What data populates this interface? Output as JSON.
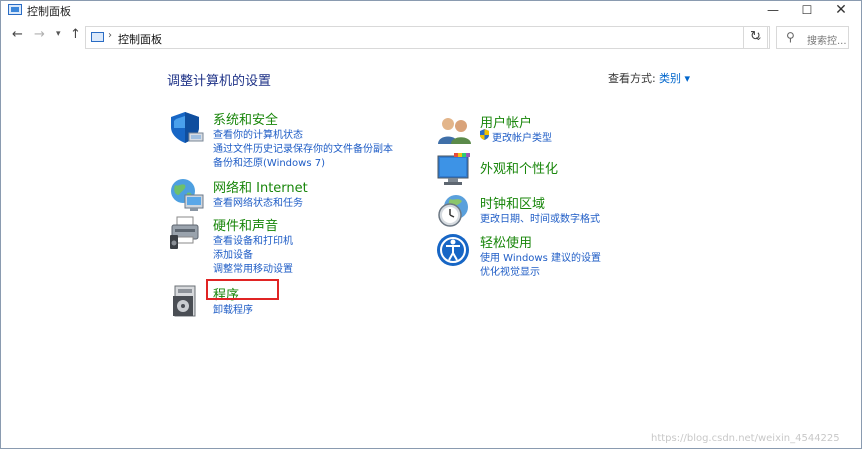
{
  "window": {
    "title": "控制面板",
    "controls": {
      "minimize": "—",
      "maximize": "☐",
      "close": "✕"
    }
  },
  "navigation": {
    "back": "←",
    "forward": "→",
    "recent": "▾",
    "up": "↑",
    "address_separator": "›",
    "address_path": "控制面板",
    "address_dropdown": "⌄",
    "refresh": "↻",
    "search_placeholder": "搜索控..."
  },
  "main": {
    "heading": "调整计算机的设置",
    "view_by_label": "查看方式:",
    "view_by_value": "类别 ▾",
    "categories_left": [
      {
        "title": "系统和安全",
        "links": [
          "查看你的计算机状态",
          "通过文件历史记录保存你的文件备份副本",
          "备份和还原(Windows 7)"
        ]
      },
      {
        "title": "网络和 Internet",
        "links": [
          "查看网络状态和任务"
        ]
      },
      {
        "title": "硬件和声音",
        "links": [
          "查看设备和打印机",
          "添加设备",
          "调整常用移动设置"
        ]
      },
      {
        "title": "程序",
        "links": [
          "卸载程序"
        ]
      }
    ],
    "categories_right": [
      {
        "title": "用户帐户",
        "links": [
          "更改帐户类型"
        ]
      },
      {
        "title": "外观和个性化",
        "links": []
      },
      {
        "title": "时钟和区域",
        "links": [
          "更改日期、时间或数字格式"
        ]
      },
      {
        "title": "轻松使用",
        "links": [
          "使用 Windows 建议的设置",
          "优化视觉显示"
        ]
      }
    ]
  },
  "watermark": "https://blog.csdn.net/weixin_4544225",
  "colors": {
    "category_title": "#18860a",
    "link": "#1f5dc6",
    "heading": "#1e3287",
    "highlight": "#e02424"
  }
}
